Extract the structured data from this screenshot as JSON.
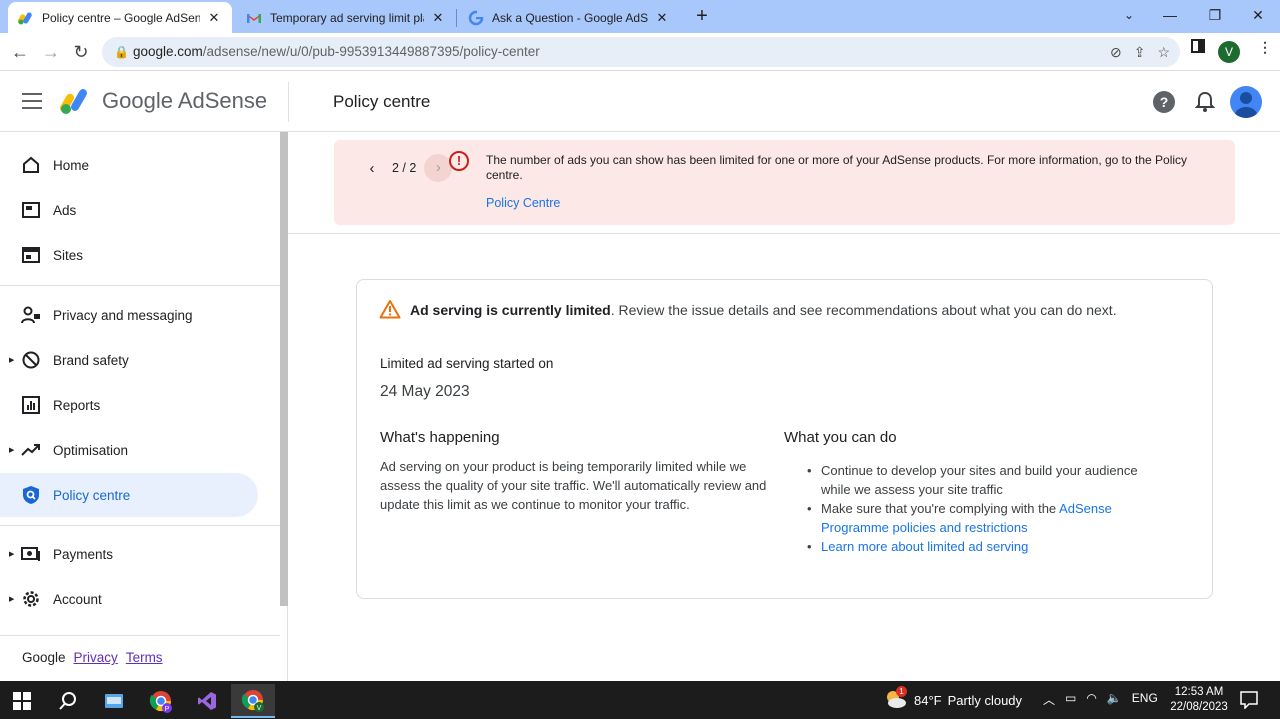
{
  "browser": {
    "tabs": [
      {
        "title": "Policy centre – Google AdSense",
        "icon": "adsense-favicon",
        "active": true
      },
      {
        "title": "Temporary ad serving limit placed",
        "icon": "gmail-favicon",
        "active": false
      },
      {
        "title": "Ask a Question - Google AdSense",
        "icon": "google-favicon",
        "active": false
      }
    ],
    "new_tab": "+",
    "window_controls": {
      "minimize": "—",
      "maximize": "❐",
      "close": "✕"
    },
    "url_host": "google.com",
    "url_path": "/adsense/new/u/0/pub-9953913449887395/policy-center",
    "profile_initial": "V"
  },
  "app": {
    "logo_text": "Google AdSense",
    "page_title": "Policy centre"
  },
  "sidebar": {
    "items": [
      {
        "label": "Home",
        "icon": "home-icon"
      },
      {
        "label": "Ads",
        "icon": "ads-icon"
      },
      {
        "label": "Sites",
        "icon": "sites-icon"
      },
      {
        "label": "Privacy and messaging",
        "icon": "privacy-icon"
      },
      {
        "label": "Brand safety",
        "icon": "block-icon"
      },
      {
        "label": "Reports",
        "icon": "reports-icon"
      },
      {
        "label": "Optimisation",
        "icon": "trend-icon"
      },
      {
        "label": "Policy centre",
        "icon": "shield-search-icon",
        "active": true
      },
      {
        "label": "Payments",
        "icon": "payments-icon"
      },
      {
        "label": "Account",
        "icon": "gear-icon"
      }
    ],
    "footer": {
      "google": "Google",
      "privacy": "Privacy",
      "terms": "Terms"
    }
  },
  "banner": {
    "pager": "2 / 2",
    "message": "The number of ads you can show has been limited for one or more of your AdSense products. For more information, go to the Policy centre.",
    "link": "Policy Centre",
    "color_bg": "#fce8e6",
    "color_icon": "#c5221f"
  },
  "card": {
    "headline_bold": "Ad serving is currently limited",
    "headline_rest": ". Review the issue details and see recommendations about what you can do next.",
    "started_label": "Limited ad serving started on",
    "started_date": "24 May 2023",
    "happening_title": "What's happening",
    "happening_text": "Ad serving on your product is being temporarily limited while we assess the quality of your site traffic. We'll automatically review and update this limit as we continue to monitor your traffic.",
    "todo_title": "What you can do",
    "todo_1": "Continue to develop your sites and build your audience while we assess your site traffic",
    "todo_2_text": "Make sure that you're complying with the ",
    "todo_2_link": "AdSense Programme policies and restrictions",
    "todo_3_link": "Learn more about limited ad serving"
  },
  "taskbar": {
    "weather_temp": "84°F",
    "weather_desc": "Partly cloudy",
    "lang": "ENG",
    "time": "12:53 AM",
    "date": "22/08/2023",
    "weather_badge": "1"
  }
}
